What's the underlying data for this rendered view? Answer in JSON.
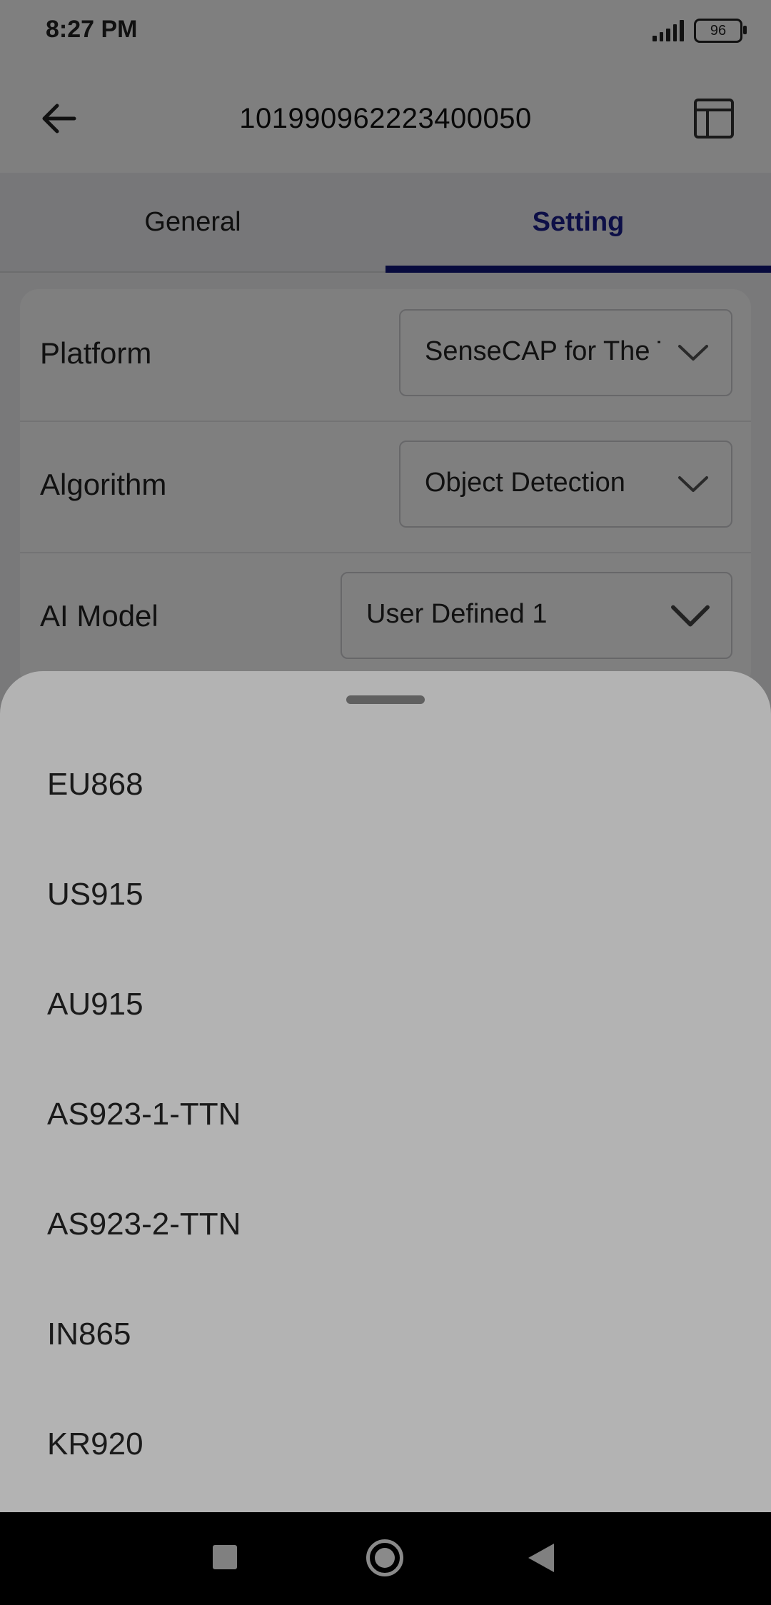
{
  "status_bar": {
    "time": "8:27 PM",
    "battery": "96"
  },
  "app_bar": {
    "title": "101990962223400050",
    "back_icon": "arrow-left-icon",
    "layout_icon": "layout-panel-icon"
  },
  "tabs": [
    {
      "label": "General",
      "selected": false
    },
    {
      "label": "Setting",
      "selected": true
    }
  ],
  "settings": {
    "platform": {
      "label": "Platform",
      "value": "SenseCAP for The Things Network"
    },
    "algorithm": {
      "label": "Algorithm",
      "value": "Object Detection"
    },
    "ai_model": {
      "label": "AI Model",
      "value": "User Defined 1"
    }
  },
  "sheet": {
    "options": [
      "EU868",
      "US915",
      "AU915",
      "AS923-1-TTN",
      "AS923-2-TTN",
      "IN865",
      "KR920"
    ]
  },
  "colors": {
    "accent": "#0f157a",
    "tab_selected_text": "#1a1f8f",
    "sheet_bg": "#b3b3b3",
    "scrim": "rgba(0,0,0,0.5)"
  }
}
